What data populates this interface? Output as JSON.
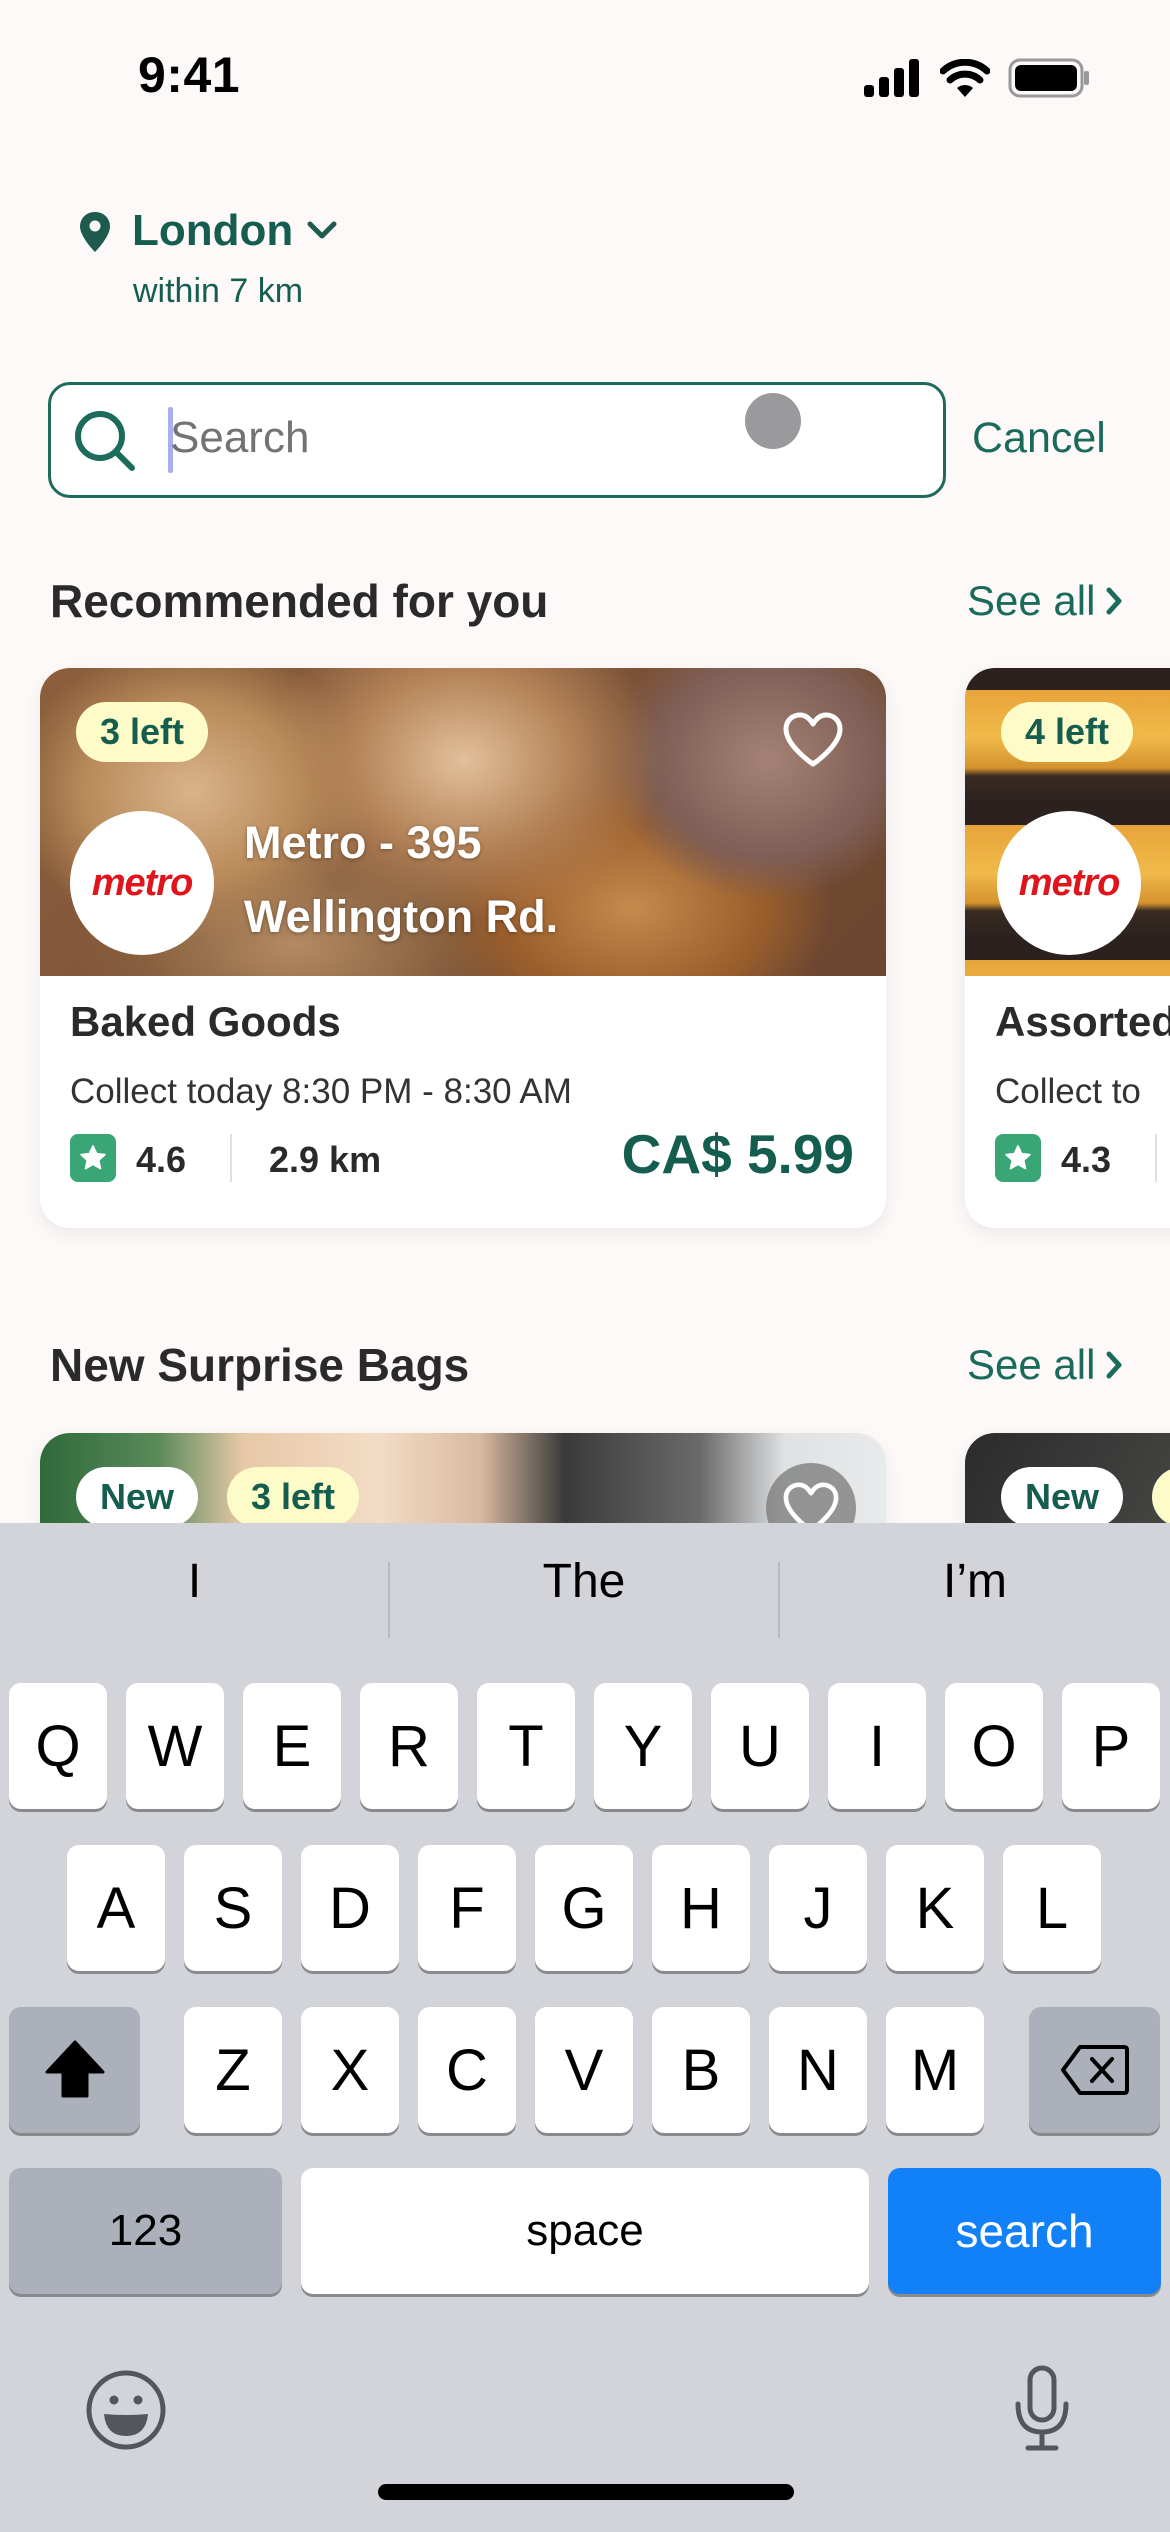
{
  "status_bar": {
    "time": "9:41"
  },
  "location": {
    "city": "London",
    "radius": "within 7 km"
  },
  "search": {
    "placeholder": "Search",
    "value": "",
    "cancel_label": "Cancel"
  },
  "colors": {
    "brand": "#155e4f",
    "badge_yellow": "#fdfcc8",
    "rating_green": "#3aa575",
    "keyboard_blue": "#1280f6"
  },
  "sections": [
    {
      "title": "Recommended for you",
      "see_all": "See all",
      "cards": [
        {
          "stock_badge": "3 left",
          "store_logo": "metro",
          "store_name": "Metro - 395 Wellington Rd.",
          "store_name_line1": "Metro - 395",
          "store_name_line2": "Wellington Rd.",
          "item": "Baked Goods",
          "collect": "Collect today 8:30 PM - 8:30 AM",
          "rating": "4.6",
          "distance": "2.9 km",
          "price": "CA$ 5.99",
          "favorited": false
        },
        {
          "stock_badge": "4 left",
          "store_logo": "metro",
          "item": "Assorted",
          "collect": "Collect to",
          "rating": "4.3",
          "favorited": false
        }
      ]
    },
    {
      "title": "New Surprise Bags",
      "see_all": "See all",
      "cards": [
        {
          "new_badge": "New",
          "stock_badge": "3 left",
          "favorited": false
        },
        {
          "new_badge": "New"
        }
      ]
    }
  ],
  "keyboard": {
    "suggestions": [
      "I",
      "The",
      "I’m"
    ],
    "rows": [
      [
        "Q",
        "W",
        "E",
        "R",
        "T",
        "Y",
        "U",
        "I",
        "O",
        "P"
      ],
      [
        "A",
        "S",
        "D",
        "F",
        "G",
        "H",
        "J",
        "K",
        "L"
      ],
      [
        "Z",
        "X",
        "C",
        "V",
        "B",
        "N",
        "M"
      ]
    ],
    "numbers_label": "123",
    "space_label": "space",
    "return_label": "search"
  }
}
